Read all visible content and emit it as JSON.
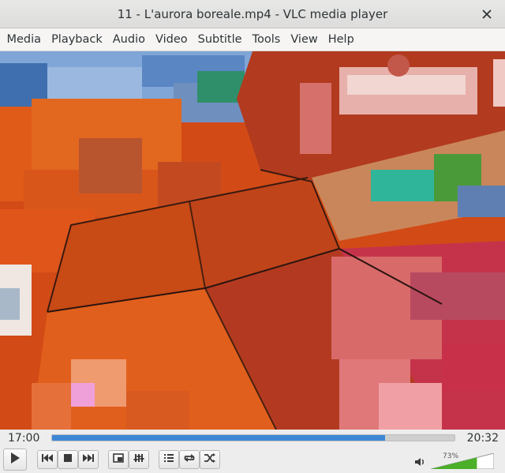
{
  "window": {
    "title": "11 - L'aurora boreale.mp4 - VLC media player",
    "close_icon": "close-icon"
  },
  "menu": {
    "items": [
      "Media",
      "Playback",
      "Audio",
      "Video",
      "Subtitle",
      "Tools",
      "View",
      "Help"
    ]
  },
  "player": {
    "elapsed": "17:00",
    "total": "20:32",
    "progress_percent": 82.8,
    "volume_label": "73%",
    "volume_percent": 73
  },
  "icons": {
    "play": "play-icon",
    "previous": "skip-previous-icon",
    "stop": "stop-icon",
    "next": "skip-next-icon",
    "fullscreen": "fullscreen-icon",
    "extended": "equalizer-icon",
    "playlist": "playlist-icon",
    "loop": "loop-icon",
    "shuffle": "shuffle-icon",
    "volume": "speaker-icon"
  },
  "colors": {
    "progress": "#3d88d6",
    "volume": "#4caf2a"
  }
}
